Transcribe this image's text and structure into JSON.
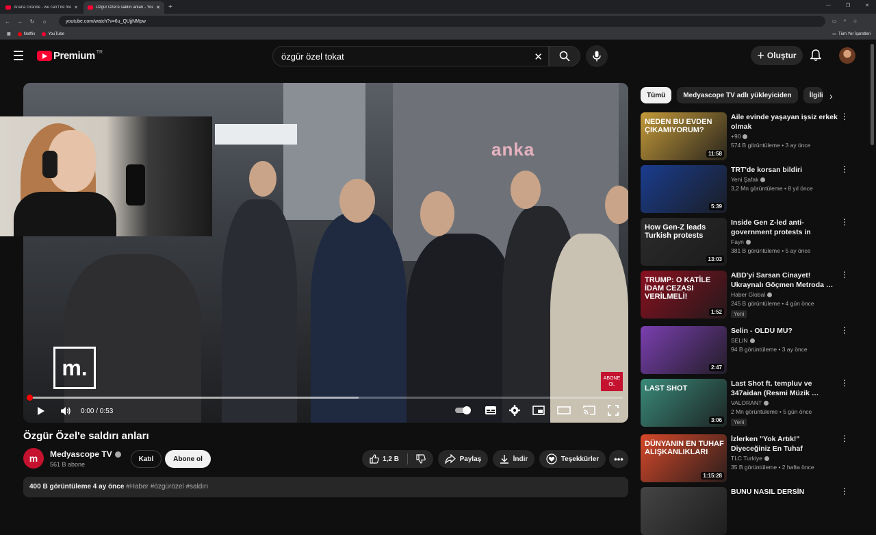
{
  "browser": {
    "tabs": [
      {
        "title": "Ariana Grande - we can't be frie",
        "active": false
      },
      {
        "title": "Özgür Özel'e saldırı anları - You",
        "active": true
      }
    ],
    "url": "youtube.com/watch?v=6u_QUjjNMpw",
    "bookmarks": [
      "Netflix",
      "YouTube"
    ],
    "bookmarks_right": "Tüm Yer İşaretleri"
  },
  "header": {
    "logo_text": "Premium",
    "logo_region": "TR",
    "search_value": "özgür özel tokat",
    "create_label": "Oluştur"
  },
  "video": {
    "watermark": "anka",
    "brand_mark": "m.",
    "abone_badge": "ABONE OL",
    "time": "0:00 / 0:53",
    "progress_fraction": 0.0,
    "buffered_fraction": 0.555,
    "title": "Özgür Özel'e saldırı anları"
  },
  "channel": {
    "name": "Medyascope TV",
    "subscribers": "561 B abone",
    "avatar_text": "m",
    "join_label": "Katıl",
    "subscribe_label": "Abone ol"
  },
  "actions": {
    "likes": "1,2 B",
    "share": "Paylaş",
    "download": "İndir",
    "thanks": "Teşekkürler"
  },
  "description": {
    "views_and_date": "400 B görüntüleme  4 ay önce",
    "tags": "#Haber #özgürözel #saldırı"
  },
  "chips": [
    "Tümü",
    "Medyascope TV adlı yükleyiciden",
    "İlgili"
  ],
  "recommendations": [
    {
      "title": "Aile evinde yaşayan işsiz erkek olmak",
      "channel": "+90",
      "verified": true,
      "meta": "574 B görüntüleme • 3 ay önce",
      "duration": "11:58",
      "thumb_text": "NEDEN BU EVDEN ÇIKAMIYORUM?",
      "new": "",
      "color": "#c49a3a"
    },
    {
      "title": "TRT'de korsan bildiri",
      "channel": "Yeni Şafak",
      "verified": true,
      "meta": "3,2 Mn görüntüleme • 8 yıl önce",
      "duration": "5:39",
      "thumb_text": "",
      "new": "",
      "color": "#1a3d8f"
    },
    {
      "title": "Inside Gen Z-led anti-government protests in Turkey…",
      "channel": "Fayn",
      "verified": true,
      "meta": "381 B görüntüleme • 5 ay önce",
      "duration": "13:03",
      "thumb_text": "How Gen-Z leads Turkish protests",
      "new": "",
      "color": "#2b2b2b"
    },
    {
      "title": "ABD'yi Sarsan Cinayet! Ukraynalı Göçmen Metroda …",
      "channel": "Haber Global",
      "verified": true,
      "meta": "245 B görüntüleme • 4 gün önce",
      "duration": "1:52",
      "thumb_text": "TRUMP: O KATİLE İDAM CEZASI VERİLMELİ!",
      "new": "Yeni",
      "color": "#8a1020"
    },
    {
      "title": "Selin - OLDU MU?",
      "channel": "SELIN",
      "verified": true,
      "meta": "94 B görüntüleme • 3 ay önce",
      "duration": "2:47",
      "thumb_text": "",
      "new": "",
      "color": "#7a3fb0"
    },
    {
      "title": "Last Shot ft. templuv ve 347aidan (Resmi Müzik …",
      "channel": "VALORANT",
      "verified": true,
      "meta": "2 Mn görüntüleme • 5 gün önce",
      "duration": "3:06",
      "thumb_text": "LAST SHOT",
      "new": "Yeni",
      "color": "#3a8a7a"
    },
    {
      "title": "İzlerken \"Yok Artık!\" Diyeceğiniz En Tuhaf Bağımlılıklar Serisi | …",
      "channel": "TLC Turkiye",
      "verified": true,
      "meta": "35 B görüntüleme • 2 hafta önce",
      "duration": "1:15:28",
      "thumb_text": "DÜNYANIN EN TUHAF ALIŞKANLIKLARI",
      "new": "",
      "color": "#d6482a"
    },
    {
      "title": "BUNU NASIL DERSİN",
      "channel": "",
      "verified": false,
      "meta": "",
      "duration": "",
      "thumb_text": "",
      "new": "",
      "color": "#444444"
    }
  ]
}
